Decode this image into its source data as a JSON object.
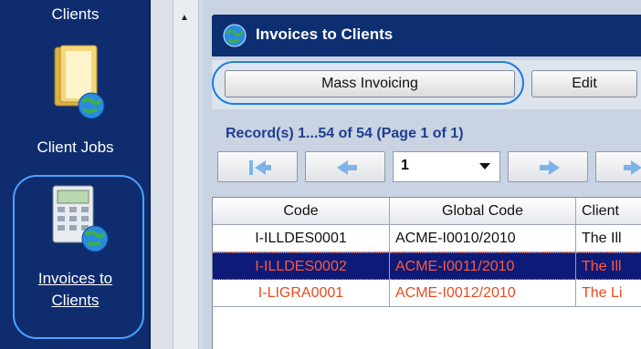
{
  "sidebar": {
    "top_label": "Clients",
    "client_jobs_label": "Client Jobs",
    "active_item": {
      "line1": "Invoices to",
      "line2": "Clients"
    }
  },
  "panel": {
    "title": "Invoices to Clients",
    "toolbar": {
      "mass_invoicing": "Mass Invoicing",
      "edit": "Edit"
    },
    "records_info": "Record(s) 1...54 of 54 (Page 1 of 1)",
    "page_select": {
      "value": "1"
    }
  },
  "table": {
    "columns": [
      "Code",
      "Global Code",
      "Client"
    ],
    "rows": [
      {
        "code": "I-ILLDES0001",
        "global_code": "ACME-I0010/2010",
        "client": "The Ill"
      },
      {
        "code": "I-ILLDES0002",
        "global_code": "ACME-I0011/2010",
        "client": "The Ill"
      },
      {
        "code": "I-LIGRA0001",
        "global_code": "ACME-I0012/2010",
        "client": "The Li"
      }
    ]
  },
  "colors": {
    "sidebar_bg": "#0f2d6e",
    "header_bg": "#0d2f72",
    "highlight_ring": "#1e7de0",
    "selected_row_bg": "#0d1a78",
    "red_text": "#ff5a3c"
  },
  "icons": [
    "folder-globe-icon",
    "calculator-globe-icon",
    "globe-icon",
    "first-page-icon",
    "prev-page-icon",
    "next-page-icon",
    "last-page-icon",
    "scroll-up-icon"
  ]
}
